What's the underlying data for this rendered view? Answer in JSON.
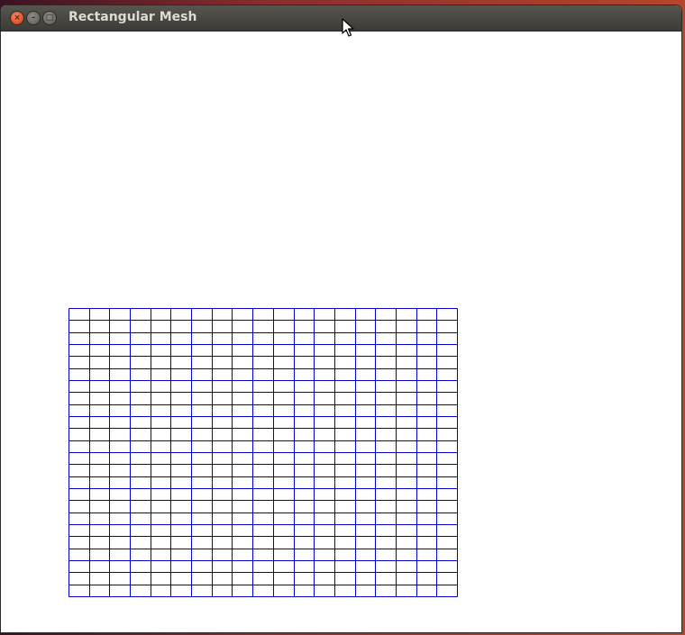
{
  "window": {
    "title": "Rectangular Mesh",
    "close_glyph": "×",
    "minimize_glyph": "–",
    "maximize_glyph": "□"
  },
  "icons": {
    "close": "close-icon",
    "minimize": "minimize-icon",
    "maximize": "maximize-icon",
    "cursor": "mouse-pointer-icon"
  },
  "colors": {
    "mesh_line": "#0000c8",
    "canvas_bg": "#ffffff",
    "titlebar": "#3c3b37",
    "close_button": "#e4532b"
  },
  "mesh": {
    "columns": 19,
    "rows": 24
  }
}
